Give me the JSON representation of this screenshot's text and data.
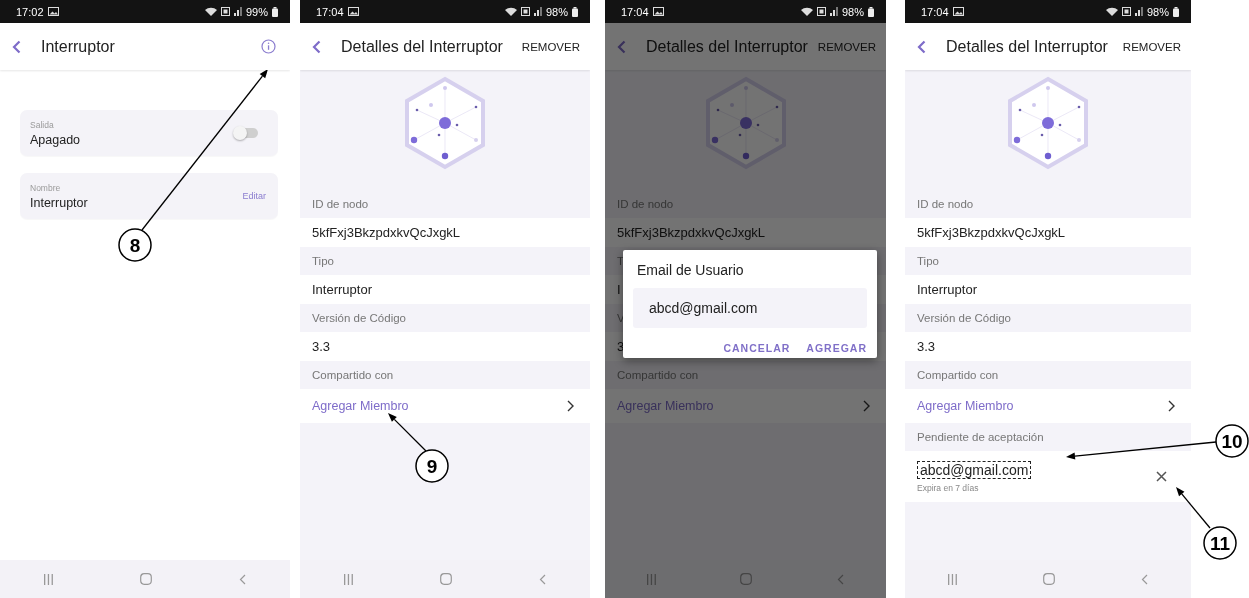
{
  "screens": [
    {
      "kind": "device",
      "status_bar": {
        "time": "17:02",
        "battery": "99%"
      },
      "title": "Interruptor",
      "cards": [
        {
          "kind": "toggle",
          "label": "Salida",
          "value": "Apagado",
          "on": false
        },
        {
          "kind": "action",
          "label": "Nombre",
          "value": "Interruptor",
          "action": "Editar"
        }
      ]
    },
    {
      "kind": "details",
      "status_bar": {
        "time": "17:04",
        "battery": "98%"
      },
      "title": "Detalles del Interruptor",
      "action": "REMOVER",
      "dimmed": false,
      "rows": [
        {
          "kind": "label",
          "text": "ID de nodo"
        },
        {
          "kind": "value",
          "text": "5kfFxj3BkzpdxkvQcJxgkL"
        },
        {
          "kind": "label",
          "text": "Tipo"
        },
        {
          "kind": "value",
          "text": "Interruptor"
        },
        {
          "kind": "label",
          "text": "Versión de Código"
        },
        {
          "kind": "value",
          "text": "3.3"
        },
        {
          "kind": "label",
          "text": "Compartido con"
        },
        {
          "kind": "link",
          "text": "Agregar Miembro"
        }
      ]
    },
    {
      "kind": "details",
      "status_bar": {
        "time": "17:04",
        "battery": "98%"
      },
      "title": "Detalles del Interruptor",
      "action": "REMOVER",
      "dimmed": true,
      "rows": [
        {
          "kind": "label",
          "text": "ID de nodo"
        },
        {
          "kind": "value",
          "text": "5kfFxj3BkzpdxkvQcJxgkL"
        },
        {
          "kind": "label",
          "text": "T"
        },
        {
          "kind": "value",
          "text": "I"
        },
        {
          "kind": "label",
          "text": "V"
        },
        {
          "kind": "value",
          "text": "3"
        },
        {
          "kind": "label",
          "text": "Compartido con"
        },
        {
          "kind": "link",
          "text": "Agregar Miembro"
        }
      ],
      "dialog": {
        "title": "Email de Usuario",
        "value": "abcd@gmail.com",
        "buttons": [
          "CANCELAR",
          "AGREGAR"
        ]
      }
    },
    {
      "kind": "details",
      "status_bar": {
        "time": "17:04",
        "battery": "98%"
      },
      "title": "Detalles del Interruptor",
      "action": "REMOVER",
      "dimmed": false,
      "rows": [
        {
          "kind": "label",
          "text": "ID de nodo"
        },
        {
          "kind": "value",
          "text": "5kfFxj3BkzpdxkvQcJxgkL"
        },
        {
          "kind": "label",
          "text": "Tipo"
        },
        {
          "kind": "value",
          "text": "Interruptor"
        },
        {
          "kind": "label",
          "text": "Versión de Código"
        },
        {
          "kind": "value",
          "text": "3.3"
        },
        {
          "kind": "label",
          "text": "Compartido con"
        },
        {
          "kind": "link",
          "text": "Agregar Miembro"
        },
        {
          "kind": "label",
          "text": "Pendiente de aceptación"
        },
        {
          "kind": "pending",
          "email": "abcd@gmail.com",
          "note": "Expira en 7 días",
          "highlighted": true
        }
      ]
    }
  ],
  "callouts": [
    {
      "number": "8"
    },
    {
      "number": "9"
    },
    {
      "number": "10"
    },
    {
      "number": "11"
    }
  ]
}
